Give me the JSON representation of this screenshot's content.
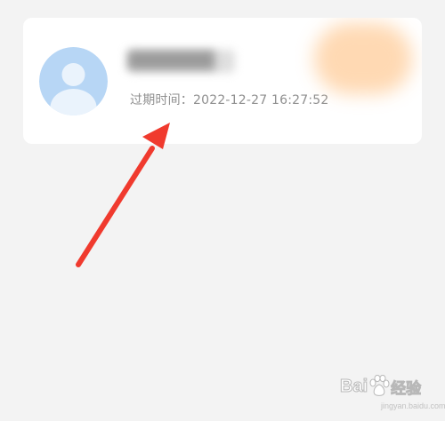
{
  "member_card": {
    "username_redacted": "███████",
    "expiry_text": "过期时间：2022-12-27 16:27:52"
  },
  "avatar": {
    "icon": "default-user-avatar-icon",
    "background_color": "#b7d6f5",
    "figure_color": "#eaf3fc"
  },
  "annotation": {
    "arrow_color": "#f03a2e",
    "arrow_icon": "red-annotation-arrow-icon"
  },
  "watermark": {
    "brand_left": "Bai",
    "brand_right": "经验",
    "url": "jingyan.baidu.com"
  }
}
